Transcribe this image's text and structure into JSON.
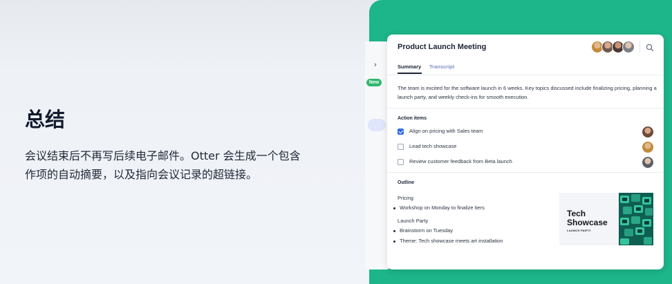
{
  "left": {
    "heading": "总结",
    "body": "会议结束后不再写后续电子邮件。Otter 会生成一个包含作项的自动摘要，以及指向会议记录的超链接。"
  },
  "back_panel": {
    "chevron": "›",
    "badge": "New"
  },
  "card": {
    "title": "Product Launch Meeting",
    "tabs": [
      {
        "label": "Summary",
        "active": true
      },
      {
        "label": "Transcript",
        "active": false
      }
    ],
    "summary": "The team is excited for the software launch in 6 weeks. Key topics discussed include finalizing pricing, planning a launch party, and weekly check-ins for smooth execution.",
    "action_items": {
      "label": "Action items",
      "items": [
        {
          "text": "Align on pricing with Sales team",
          "checked": true
        },
        {
          "text": "Lead tech showcase",
          "checked": false
        },
        {
          "text": "Review customer feedback from Beta launch",
          "checked": false
        }
      ]
    },
    "outline": {
      "label": "Outline",
      "groups": [
        {
          "title": "Pricing",
          "items": [
            "Workshop on Monday to finalize tiers"
          ]
        },
        {
          "title": "Launch Party",
          "items": [
            "Brainstorm on Tuesday",
            "Theme: Tech showcase meets art installation"
          ]
        }
      ]
    },
    "thumbnail": {
      "title_line1": "Tech",
      "title_line2": "Showcase",
      "subtitle": "LAUNCH PARTY"
    }
  },
  "colors": {
    "green_panel": "#1db58a",
    "accent_blue": "#2f6de1",
    "tab_inactive": "#7f93c4"
  },
  "icons": {
    "search": "search-icon",
    "check": "check-icon"
  }
}
